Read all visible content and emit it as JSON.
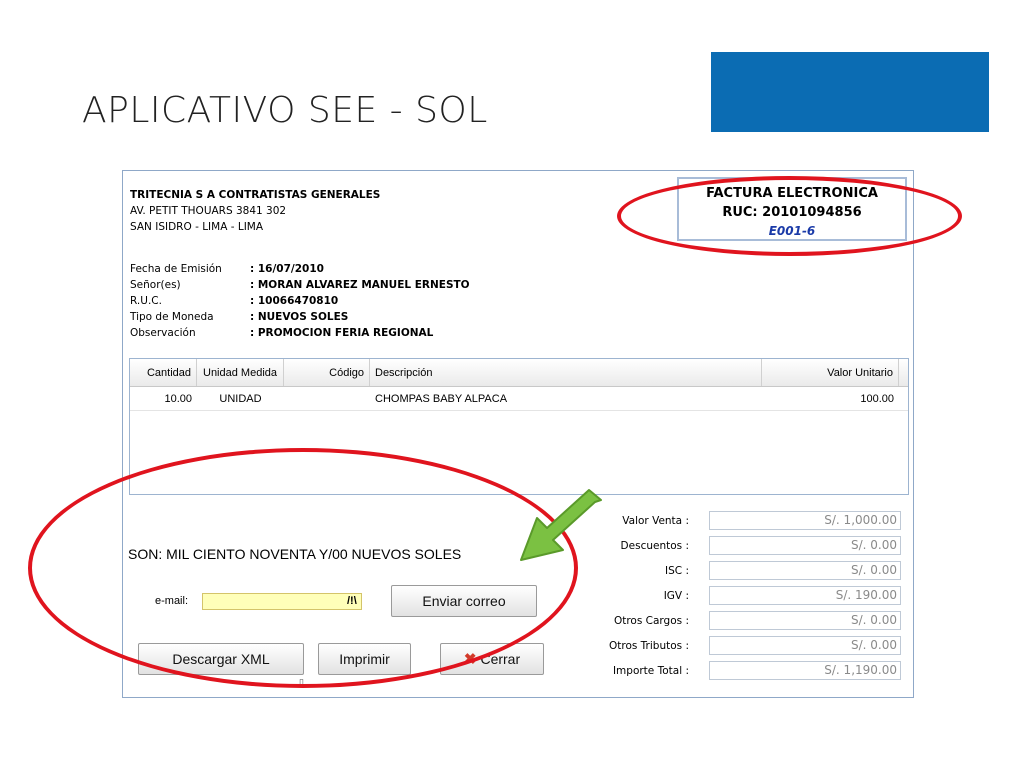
{
  "slide": {
    "title": "APLICATIVO SEE - SOL",
    "accent_color": "#0b6cb3"
  },
  "company": {
    "name": "TRITECNIA S A CONTRATISTAS GENERALES",
    "address_line1": "AV. PETIT THOUARS 3841 302",
    "address_line2": "SAN ISIDRO - LIMA - LIMA"
  },
  "document": {
    "type": "FACTURA ELECTRONICA",
    "ruc": "RUC: 20101094856",
    "number": "E001-6"
  },
  "meta": [
    {
      "label": "Fecha de Emisión",
      "value": ": 16/07/2010"
    },
    {
      "label": "Señor(es)",
      "value": ": MORAN ALVAREZ MANUEL ERNESTO"
    },
    {
      "label": "R.U.C.",
      "value": ": 10066470810"
    },
    {
      "label": "Tipo de Moneda",
      "value": ": NUEVOS SOLES"
    },
    {
      "label": "Observación",
      "value": ": PROMOCION FERIA REGIONAL"
    }
  ],
  "grid": {
    "headers": [
      "Cantidad",
      "Unidad Medida",
      "Código",
      "Descripción",
      "Valor Unitario"
    ],
    "rows": [
      [
        "10.00",
        "UNIDAD",
        "",
        "CHOMPAS BABY ALPACA",
        "100.00"
      ]
    ]
  },
  "amount_in_words": "SON: MIL CIENTO NOVENTA Y/00 NUEVOS SOLES",
  "email": {
    "label": "e-mail:",
    "value": "",
    "warning_glyph": "/!\\"
  },
  "buttons": {
    "send_email": "Enviar correo",
    "download_xml": "Descargar XML",
    "print": "Imprimir",
    "close": "Cerrar"
  },
  "totals": [
    {
      "label": "Valor Venta :",
      "value": "S/. 1,000.00"
    },
    {
      "label": "Descuentos :",
      "value": "S/. 0.00"
    },
    {
      "label": "ISC :",
      "value": "S/. 0.00"
    },
    {
      "label": "IGV :",
      "value": "S/. 190.00"
    },
    {
      "label": "Otros Cargos :",
      "value": "S/. 0.00"
    },
    {
      "label": "Otros Tributos :",
      "value": "S/. 0.00"
    },
    {
      "label": "Importe Total :",
      "value": "S/. 1,190.00"
    }
  ],
  "annotation_colors": {
    "ellipse": "#e0141e",
    "arrow": "#7bc142"
  }
}
